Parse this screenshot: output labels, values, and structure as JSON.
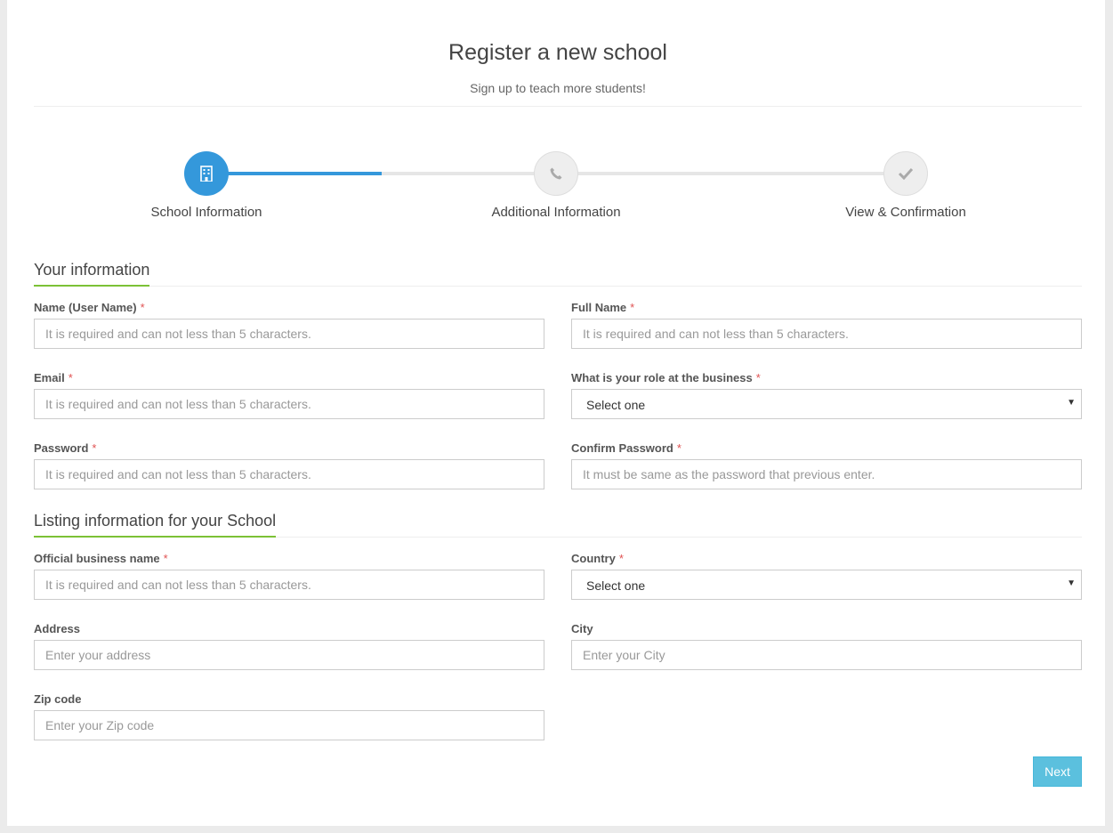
{
  "header": {
    "title": "Register a new school",
    "subtitle": "Sign up to teach more students!"
  },
  "stepper": {
    "progress_fraction": 0.33,
    "steps": [
      {
        "label": "School Information",
        "icon": "building-icon",
        "state": "active"
      },
      {
        "label": "Additional Information",
        "icon": "phone-icon",
        "state": "inactive"
      },
      {
        "label": "View & Confirmation",
        "icon": "checkmark-icon",
        "state": "inactive"
      }
    ]
  },
  "colors": {
    "accent": "#3498db",
    "section_underline": "#7cc136",
    "required": "#e05252",
    "button": "#5bc0de"
  },
  "sections": {
    "your_information": {
      "title": "Your information",
      "fields": {
        "username": {
          "label": "Name (User Name)",
          "required": "*",
          "placeholder": "It is required and can not less than 5 characters."
        },
        "full_name": {
          "label": "Full Name",
          "required": "*",
          "placeholder": "It is required and can not less than 5 characters."
        },
        "email": {
          "label": "Email",
          "required": "*",
          "placeholder": "It is required and can not less than 5 characters."
        },
        "role": {
          "label": "What is your role at the business",
          "required": "*",
          "value": "Select one"
        },
        "password": {
          "label": "Password",
          "required": "*",
          "placeholder": "It is required and can not less than 5 characters."
        },
        "confirm_password": {
          "label": "Confirm Password",
          "required": "*",
          "placeholder": "It must be same as the password that previous enter."
        }
      }
    },
    "listing_information": {
      "title": "Listing information for your School",
      "fields": {
        "business_name": {
          "label": "Official business name",
          "required": "*",
          "placeholder": "It is required and can not less than 5 characters."
        },
        "country": {
          "label": "Country",
          "required": "*",
          "value": "Select one"
        },
        "address": {
          "label": "Address",
          "placeholder": "Enter your address"
        },
        "city": {
          "label": "City",
          "placeholder": "Enter your City"
        },
        "zip": {
          "label": "Zip code",
          "placeholder": "Enter your Zip code"
        }
      }
    }
  },
  "actions": {
    "next_label": "Next"
  }
}
